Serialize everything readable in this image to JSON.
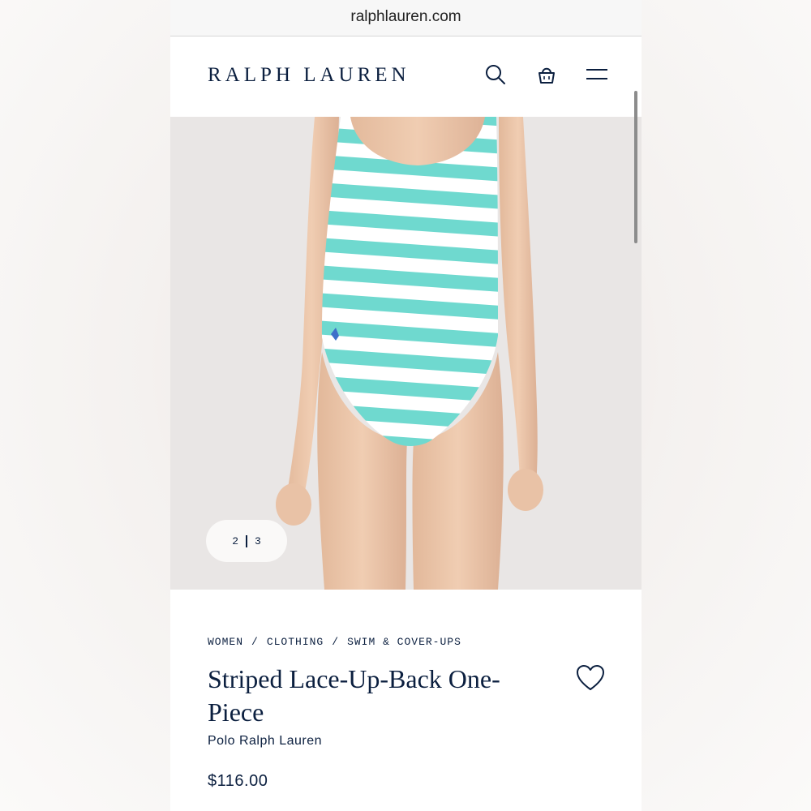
{
  "browser": {
    "url": "ralphlauren.com"
  },
  "header": {
    "logo": "RALPH LAUREN",
    "icons": [
      "search-icon",
      "shopping-bag-icon",
      "menu-icon"
    ]
  },
  "gallery": {
    "current": "2",
    "total": "3",
    "image_alt": "Model wearing teal and white striped one-piece swimsuit"
  },
  "product": {
    "breadcrumb": [
      "WOMEN",
      "/",
      "CLOTHING",
      "/",
      "SWIM & COVER-UPS"
    ],
    "title": "Striped Lace-Up-Back One-Piece",
    "brand": "Polo Ralph Lauren",
    "price": "$116.00"
  },
  "colors": {
    "navy": "#0b1f3f",
    "stripe_teal": "#6fd9cf",
    "background": "#e9e6e5"
  }
}
